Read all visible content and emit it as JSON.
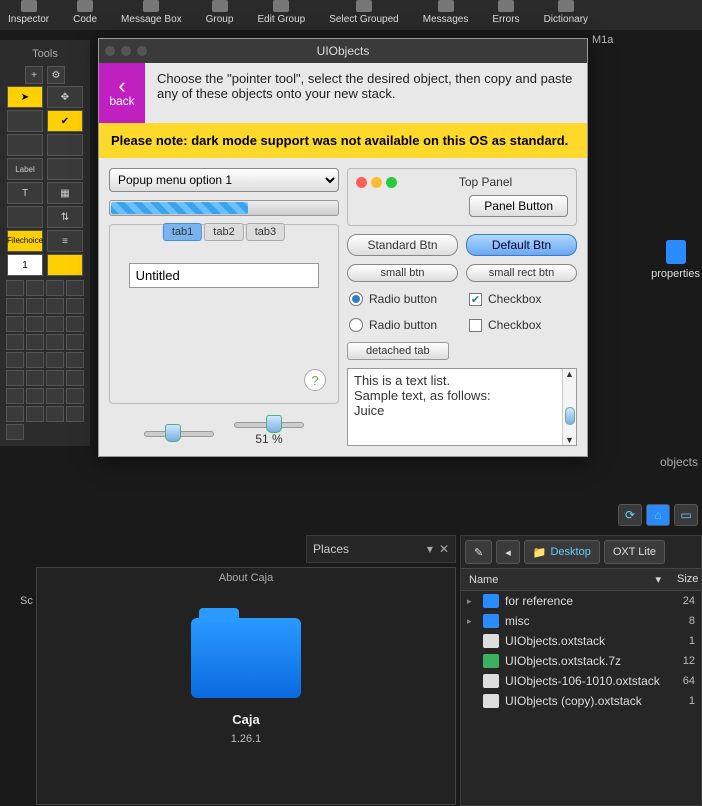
{
  "toolbar": {
    "items": [
      {
        "label": "Inspector"
      },
      {
        "label": "Code"
      },
      {
        "label": "Message Box"
      },
      {
        "label": "Group"
      },
      {
        "label": "Edit Group"
      },
      {
        "label": "Select Grouped"
      },
      {
        "label": "Messages"
      },
      {
        "label": "Errors"
      },
      {
        "label": "Dictionary"
      }
    ]
  },
  "palette": {
    "title": "Tools",
    "file_label": "File",
    "choice_label": "choice",
    "num_field": "1"
  },
  "ui_window": {
    "title": "UIObjects",
    "back": "back",
    "instructions": "Choose the \"pointer tool\", select the desired object, then copy and paste any of these objects onto your new stack.",
    "warning": "Please note: dark mode support was not available on this OS as standard.",
    "popup_selected": "Popup menu option 1",
    "tabs": [
      "tab1",
      "tab2",
      "tab3"
    ],
    "untitled": "Untitled",
    "slider_pct": "51 %",
    "top_panel": {
      "title": "Top Panel",
      "panel_button": "Panel Button"
    },
    "buttons": {
      "standard": "Standard Btn",
      "default": "Default Btn",
      "small": "small btn",
      "small_rect": "small rect btn",
      "detached": "detached tab"
    },
    "radios": {
      "r1": "Radio button",
      "r2": "Radio button"
    },
    "checks": {
      "c1": "Checkbox",
      "c2": "Checkbox"
    },
    "text_list": [
      "This is a text list.",
      "Sample text, as follows:",
      "",
      "Juice"
    ]
  },
  "about": {
    "title": "About Caja",
    "name": "Caja",
    "version": "1.26.1"
  },
  "places": {
    "label": "Places"
  },
  "fm": {
    "desktop_btn": "Desktop",
    "oxt_btn": "OXT Lite",
    "col_name": "Name",
    "col_size": "Size",
    "rows": [
      {
        "name": "for reference",
        "size": "24",
        "type": "folder"
      },
      {
        "name": "misc",
        "size": "8",
        "type": "folder"
      },
      {
        "name": "UIObjects.oxtstack",
        "size": "1",
        "type": "file"
      },
      {
        "name": "UIObjects.oxtstack.7z",
        "size": "12",
        "type": "zip"
      },
      {
        "name": "UIObjects-106-1010.oxtstack",
        "size": "64",
        "type": "file"
      },
      {
        "name": "UIObjects (copy).oxtstack",
        "size": "1",
        "type": "file"
      }
    ]
  },
  "desktop_icon": {
    "label": "properties"
  },
  "fragments": {
    "objects": "objects",
    "sc": "Sc",
    "m1a": "M1a"
  }
}
